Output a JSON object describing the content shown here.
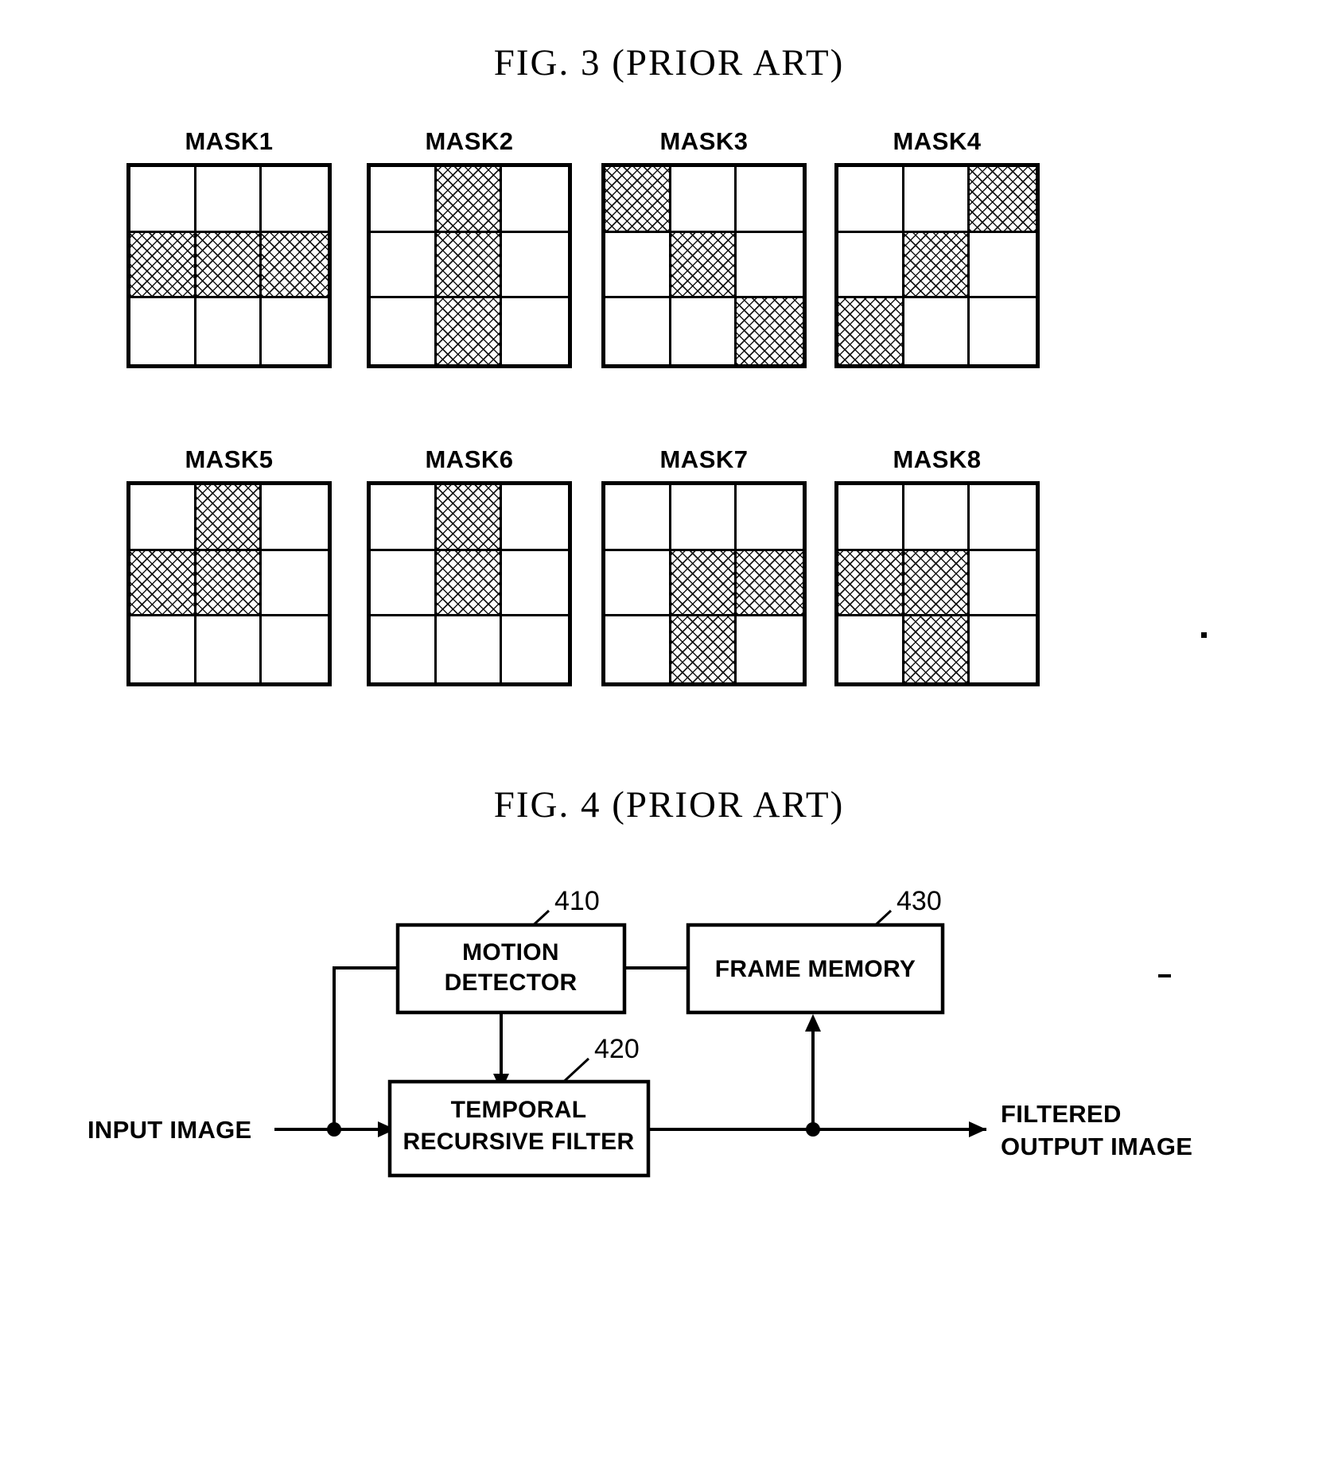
{
  "figures": {
    "fig3": {
      "title": "FIG. 3 (PRIOR ART)",
      "masks": [
        {
          "label": "MASK1",
          "cells": [
            0,
            0,
            0,
            1,
            1,
            1,
            0,
            0,
            0
          ]
        },
        {
          "label": "MASK2",
          "cells": [
            0,
            1,
            0,
            0,
            1,
            0,
            0,
            1,
            0
          ]
        },
        {
          "label": "MASK3",
          "cells": [
            1,
            0,
            0,
            0,
            1,
            0,
            0,
            0,
            1
          ]
        },
        {
          "label": "MASK4",
          "cells": [
            0,
            0,
            1,
            0,
            1,
            0,
            1,
            0,
            0
          ]
        },
        {
          "label": "MASK5",
          "cells": [
            0,
            1,
            0,
            1,
            1,
            0,
            0,
            0,
            0
          ]
        },
        {
          "label": "MASK6",
          "cells": [
            0,
            1,
            0,
            0,
            1,
            0,
            0,
            0,
            0
          ]
        },
        {
          "label": "MASK7",
          "cells": [
            0,
            0,
            0,
            0,
            1,
            1,
            0,
            1,
            0
          ]
        },
        {
          "label": "MASK8",
          "cells": [
            0,
            0,
            0,
            1,
            1,
            0,
            0,
            1,
            0
          ]
        }
      ]
    },
    "fig4": {
      "title": "FIG. 4 (PRIOR ART)",
      "blocks": {
        "motion_detector": {
          "line1": "MOTION",
          "line2": "DETECTOR",
          "ref": "410"
        },
        "frame_memory": {
          "line1": "FRAME MEMORY",
          "line2": "",
          "ref": "430"
        },
        "temporal_filter": {
          "line1": "TEMPORAL",
          "line2": "RECURSIVE FILTER",
          "ref": "420"
        }
      },
      "io": {
        "input_label": "INPUT IMAGE",
        "output_line1": "FILTERED",
        "output_line2": "OUTPUT IMAGE"
      }
    }
  },
  "colors": {
    "ink": "#000000",
    "paper": "#ffffff"
  }
}
